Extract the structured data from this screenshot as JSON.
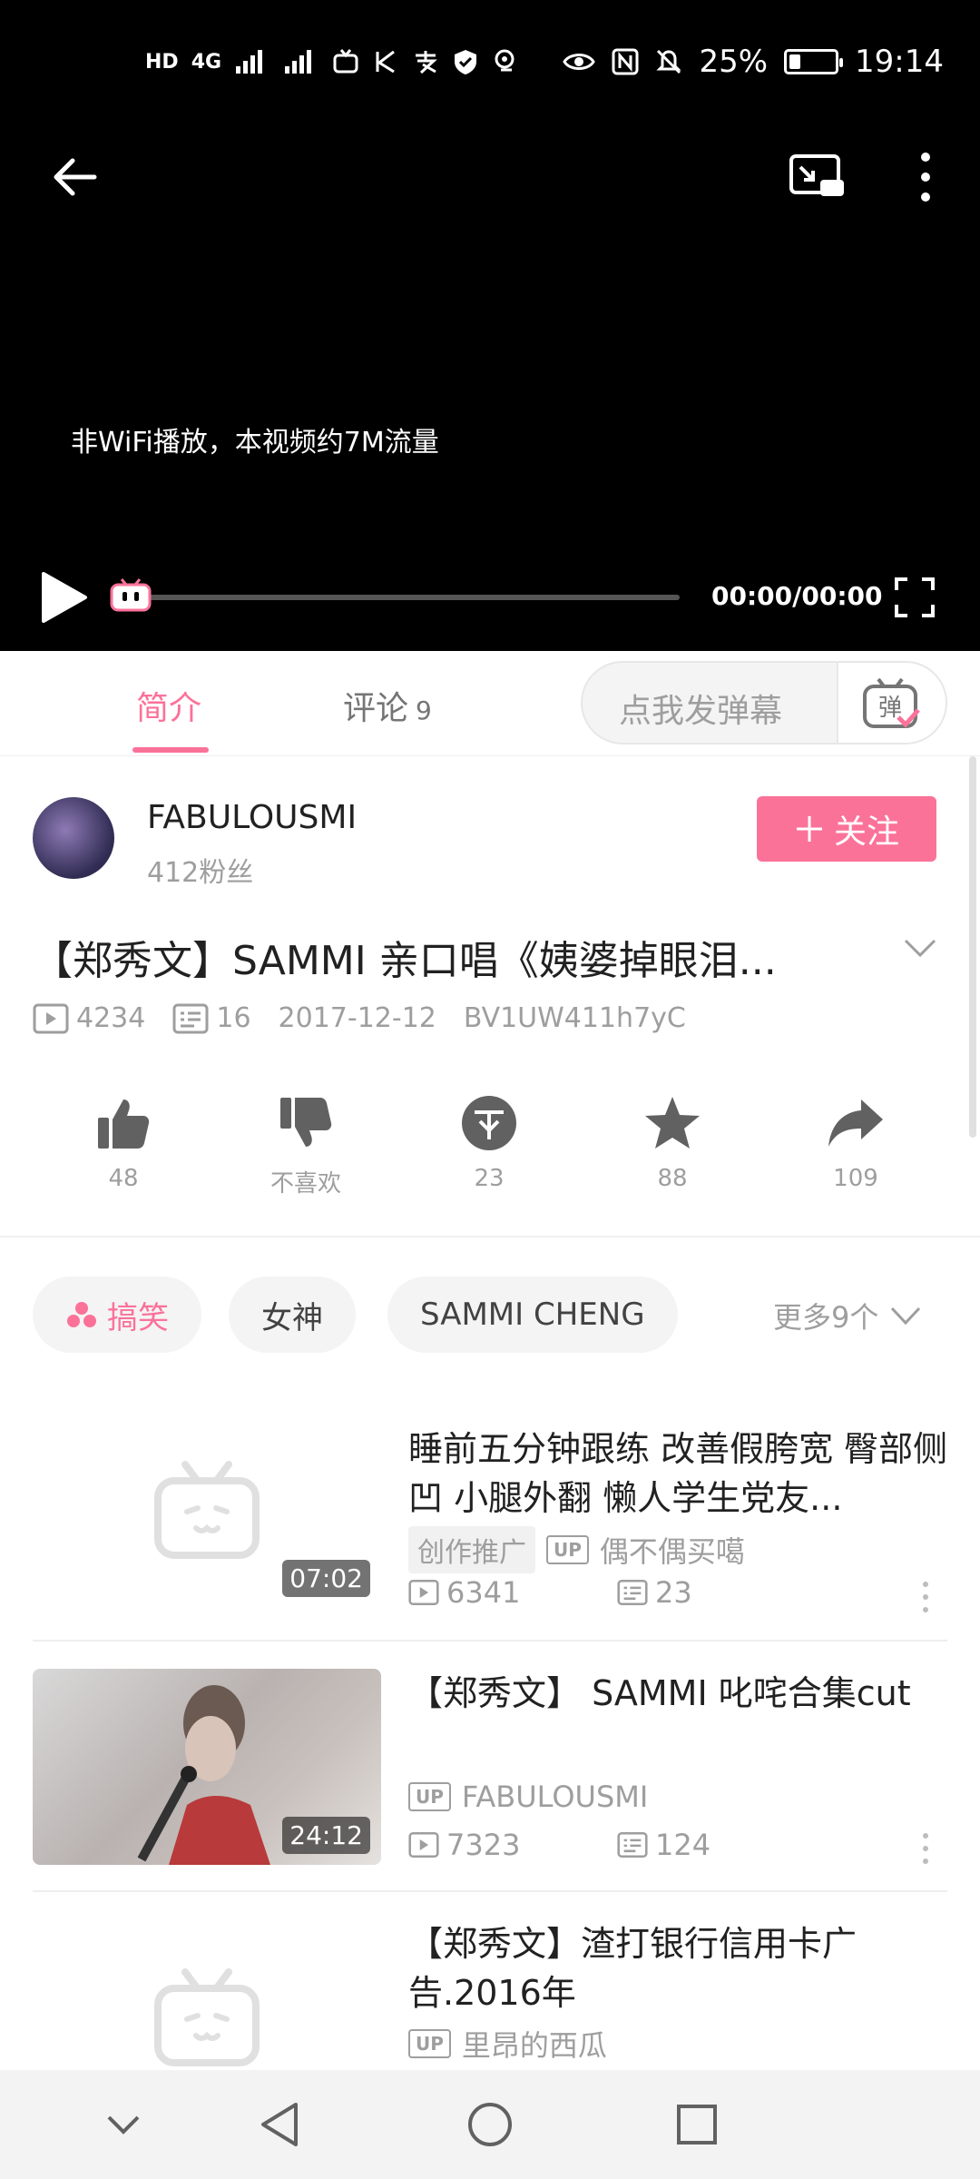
{
  "status_bar": {
    "network": "4G",
    "battery": "25%",
    "battery_level": 0.25,
    "time": "19:14"
  },
  "player": {
    "notice": "非WiFi播放，本视频约7M流量",
    "time": "00:00/00:00",
    "progress": 0
  },
  "tabs": [
    {
      "label": "简介",
      "active": true
    },
    {
      "label": "评论",
      "count": "9",
      "active": false
    }
  ],
  "danmaku": {
    "placeholder": "点我发弹幕"
  },
  "uploader": {
    "name": "FABULOUSMI",
    "fans": "412粉丝",
    "follow_label": "关注"
  },
  "video": {
    "title": "【郑秀文】SAMMI 亲口唱《姨婆掉眼泪...",
    "views": "4234",
    "danmaku_count": "16",
    "date": "2017-12-12",
    "bvid": "BV1UW411h7yC"
  },
  "actions": [
    {
      "name": "like",
      "label": "48"
    },
    {
      "name": "dislike",
      "label": "不喜欢"
    },
    {
      "name": "coin",
      "label": "23"
    },
    {
      "name": "favorite",
      "label": "88"
    },
    {
      "name": "share",
      "label": "109"
    }
  ],
  "tags": [
    {
      "label": "搞笑"
    },
    {
      "label": "女神"
    },
    {
      "label": "SAMMI CHENG"
    }
  ],
  "more_tags": "更多9个",
  "recommend": [
    {
      "title": "睡前五分钟跟练 改善假胯宽 臀部侧凹 小腿外翻 懒人学生党友...",
      "promo": "创作推广",
      "up": "偶不偶买噶",
      "views": "6341",
      "danmaku": "23",
      "duration": "07:02"
    },
    {
      "title": "【郑秀文】 SAMMI 叱咤合集cut",
      "up": "FABULOUSMI",
      "views": "7323",
      "danmaku": "124",
      "duration": "24:12"
    },
    {
      "title": "【郑秀文】渣打银行信用卡广告.2016年",
      "up": "里昂的西瓜"
    }
  ],
  "icons": {
    "accent": "#fb7299"
  }
}
